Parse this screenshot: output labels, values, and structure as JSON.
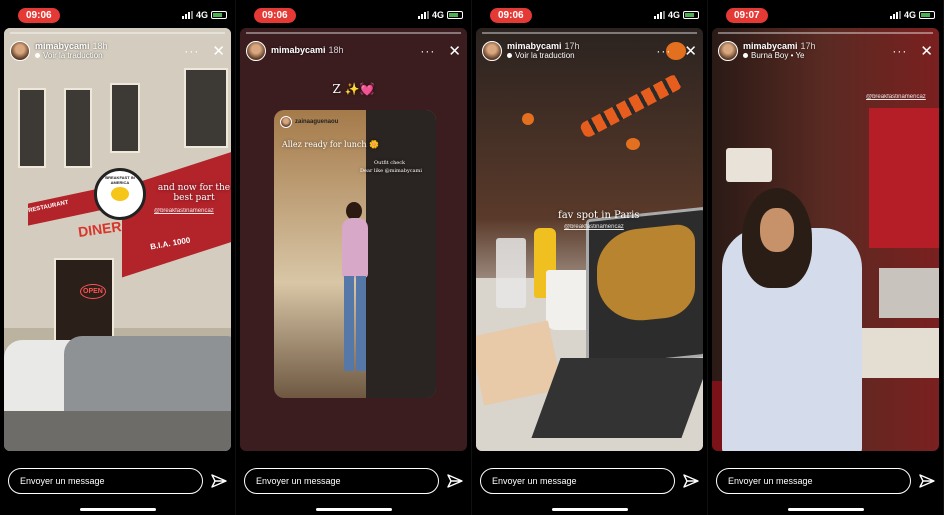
{
  "stories": [
    {
      "time": "09:06",
      "network": "4G",
      "username": "mimabycami",
      "ago": "18h",
      "subtitle": "Voir la traduction",
      "overlay": "and now for the best part",
      "mention": "@breakfastinamericaz",
      "sign_logo": "BREAKFAST IN AMERICA",
      "sign_name": "DINER",
      "sign_restaurant": "RESTAURANT",
      "sign_number": "B.I.A. 1000",
      "sign_open": "OPEN",
      "message_placeholder": "Envoyer un message"
    },
    {
      "time": "09:06",
      "network": "4G",
      "username": "mimabycami",
      "ago": "18h",
      "overlay": "Z ✨💓",
      "inner_user": "zainaaguenaou",
      "inner_caption": "Allez ready for lunch 🌼",
      "inner_sub1": "Outfit check",
      "inner_sub2": "Dear like @mimabycami",
      "message_placeholder": "Envoyer un message"
    },
    {
      "time": "09:06",
      "network": "4G",
      "username": "mimabycami",
      "ago": "17h",
      "subtitle": "Voir la traduction",
      "overlay": "fav spot in Paris",
      "mention": "@breakfastinamericaz",
      "message_placeholder": "Envoyer un message"
    },
    {
      "time": "09:07",
      "network": "4G",
      "username": "mimabycami",
      "ago": "17h",
      "subtitle": "Burna Boy • Ye",
      "mention": "@breakfastinamericaz",
      "message_placeholder": "Envoyer un message"
    }
  ]
}
